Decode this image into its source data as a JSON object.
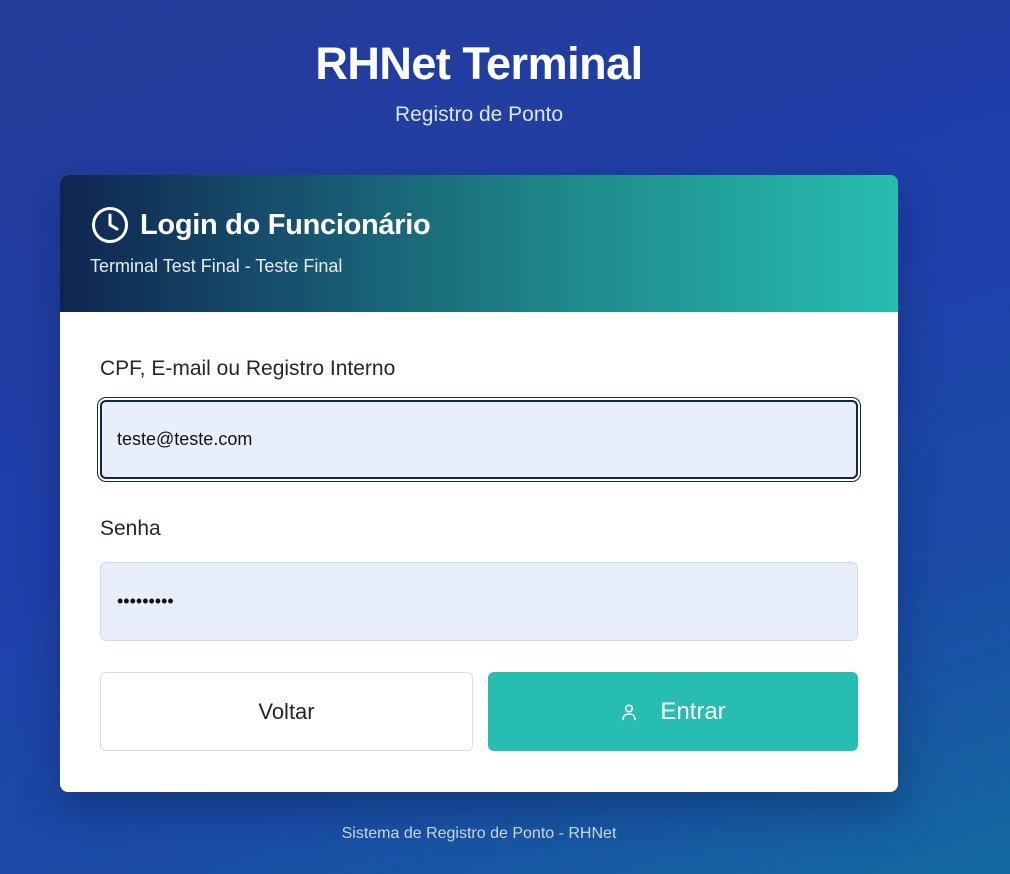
{
  "app": {
    "title": "RHNet Terminal",
    "subtitle": "Registro de Ponto"
  },
  "login_card": {
    "title": "Login do Funcionário",
    "subtitle": "Terminal Test Final - Teste Final",
    "header_icon": "clock-icon",
    "fields": {
      "identifier": {
        "label": "CPF, E-mail ou Registro Interno",
        "value": "teste@teste.com",
        "focused": true
      },
      "password": {
        "label": "Senha",
        "value": "123456789"
      }
    },
    "buttons": {
      "back_label": "Voltar",
      "submit_label": "Entrar",
      "submit_icon": "user-icon"
    }
  },
  "footer": {
    "text": "Sistema de Registro de Ponto - RHNet"
  },
  "colors": {
    "accent": "#27bdb0",
    "header_start": "#0f2550",
    "background": "#1f3fab",
    "input_bg": "#e8effb"
  }
}
